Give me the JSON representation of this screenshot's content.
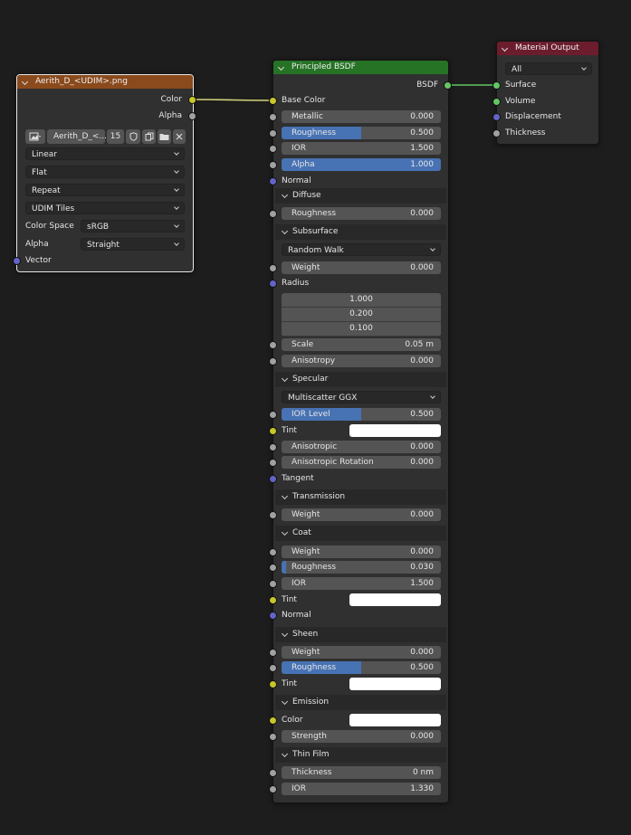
{
  "image_node": {
    "title": "Aerith_D_<UDIM>.png",
    "outputs": [
      "Color",
      "Alpha"
    ],
    "image_name": "Aerith_D_<...",
    "users": "15",
    "interpolation": "Linear",
    "projection": "Flat",
    "extension": "Repeat",
    "source": "UDIM Tiles",
    "color_space_label": "Color Space",
    "color_space": "sRGB",
    "alpha_label": "Alpha",
    "alpha": "Straight",
    "vector_label": "Vector",
    "header_color": "#8a4a1c"
  },
  "bsdf": {
    "title": "Principled BSDF",
    "output": "BSDF",
    "header_color": "#267326",
    "base_color": "Base Color",
    "metallic": {
      "label": "Metallic",
      "value": "0.000"
    },
    "roughness": {
      "label": "Roughness",
      "value": "0.500",
      "fill": 0.5
    },
    "ior": {
      "label": "IOR",
      "value": "1.500"
    },
    "alpha": {
      "label": "Alpha",
      "value": "1.000",
      "fill": 1.0
    },
    "normal": "Normal",
    "diffuse": {
      "title": "Diffuse",
      "roughness": {
        "label": "Roughness",
        "value": "0.000"
      }
    },
    "subsurface": {
      "title": "Subsurface",
      "method": "Random Walk",
      "weight": {
        "label": "Weight",
        "value": "0.000"
      },
      "radius_label": "Radius",
      "radius": [
        "1.000",
        "0.200",
        "0.100"
      ],
      "scale": {
        "label": "Scale",
        "value": "0.05 m"
      },
      "anisotropy": {
        "label": "Anisotropy",
        "value": "0.000"
      }
    },
    "specular": {
      "title": "Specular",
      "distribution": "Multiscatter GGX",
      "ior_level": {
        "label": "IOR Level",
        "value": "0.500",
        "fill": 0.5
      },
      "tint": "Tint",
      "anisotropic": {
        "label": "Anisotropic",
        "value": "0.000"
      },
      "anisotropic_rotation": {
        "label": "Anisotropic Rotation",
        "value": "0.000"
      },
      "tangent": "Tangent"
    },
    "transmission": {
      "title": "Transmission",
      "weight": {
        "label": "Weight",
        "value": "0.000"
      }
    },
    "coat": {
      "title": "Coat",
      "weight": {
        "label": "Weight",
        "value": "0.000"
      },
      "roughness": {
        "label": "Roughness",
        "value": "0.030",
        "fill": 0.03
      },
      "ior": {
        "label": "IOR",
        "value": "1.500"
      },
      "tint": "Tint",
      "normal": "Normal"
    },
    "sheen": {
      "title": "Sheen",
      "weight": {
        "label": "Weight",
        "value": "0.000"
      },
      "roughness": {
        "label": "Roughness",
        "value": "0.500",
        "fill": 0.5
      },
      "tint": "Tint"
    },
    "emission": {
      "title": "Emission",
      "color": "Color",
      "strength": {
        "label": "Strength",
        "value": "0.000"
      }
    },
    "thin_film": {
      "title": "Thin Film",
      "thickness": {
        "label": "Thickness",
        "value": "0 nm"
      },
      "ior": {
        "label": "IOR",
        "value": "1.330"
      }
    }
  },
  "output_node": {
    "title": "Material Output",
    "header_color": "#6b1d2e",
    "target": "All",
    "inputs": [
      "Surface",
      "Volume",
      "Displacement",
      "Thickness"
    ]
  },
  "colors": {
    "background": "#1d1d1d",
    "node_body": "#303030",
    "field": "#545454",
    "slider_fill": "#4772b3",
    "socket_color": "#c7c729",
    "socket_float": "#a1a1a1",
    "socket_vector": "#6363c7",
    "socket_shader": "#63c763"
  }
}
